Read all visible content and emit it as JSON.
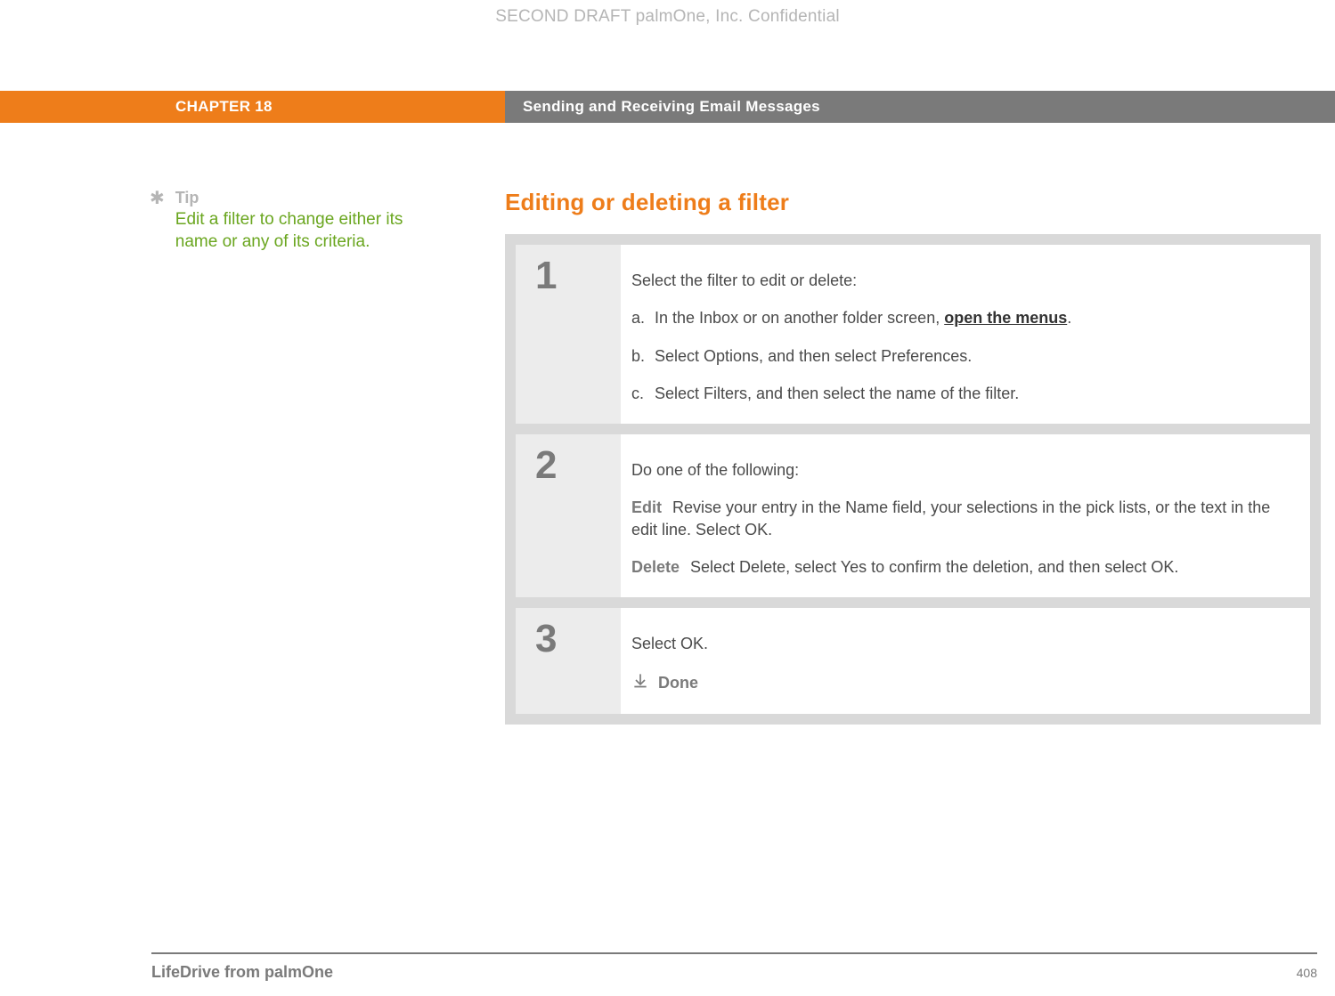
{
  "watermark": "SECOND DRAFT palmOne, Inc.  Confidential",
  "header": {
    "chapter": "CHAPTER 18",
    "title": "Sending and Receiving Email Messages"
  },
  "sidebar": {
    "tip_label": "Tip",
    "tip_text": "Edit a filter to change either its name or any of its criteria."
  },
  "section_heading": "Editing or deleting a filter",
  "steps": [
    {
      "num": "1",
      "lead": "Select the filter to edit or delete:",
      "subs": [
        {
          "letter": "a.",
          "prefix": "In the Inbox or on another folder screen, ",
          "link": "open the menus",
          "suffix": "."
        },
        {
          "letter": "b.",
          "text": "Select Options, and then select Preferences."
        },
        {
          "letter": "c.",
          "text": "Select Filters, and then select the name of the filter."
        }
      ]
    },
    {
      "num": "2",
      "lead": "Do one of the following:",
      "options": [
        {
          "label": "Edit",
          "text": "Revise your entry in the Name field, your selections in the pick lists, or the text in the edit line. Select OK."
        },
        {
          "label": "Delete",
          "text": "Select Delete, select Yes to confirm the deletion, and then select OK."
        }
      ]
    },
    {
      "num": "3",
      "lead": "Select OK.",
      "done_label": "Done"
    }
  ],
  "footer": {
    "title": "LifeDrive from palmOne",
    "page": "408"
  }
}
